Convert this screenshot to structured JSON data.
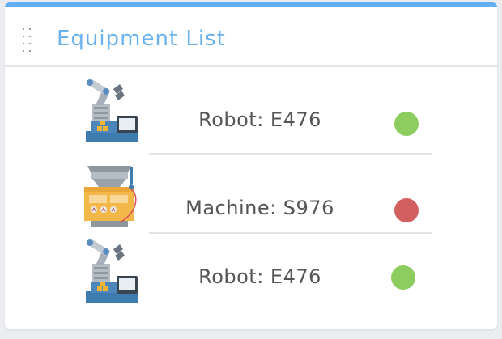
{
  "panel": {
    "title": "Equipment List",
    "accent_color": "#63aef0",
    "handle_icon": "drag-handle-icon"
  },
  "equipment": [
    {
      "label": "Robot: E476",
      "icon": "robot-arm-icon",
      "status": "ok",
      "status_color": "#8dcc5e"
    },
    {
      "label": "Machine: S976",
      "icon": "machine-icon",
      "status": "error",
      "status_color": "#d36060"
    },
    {
      "label": "Robot: E476",
      "icon": "robot-arm-icon",
      "status": "ok",
      "status_color": "#8dcc5e"
    }
  ]
}
